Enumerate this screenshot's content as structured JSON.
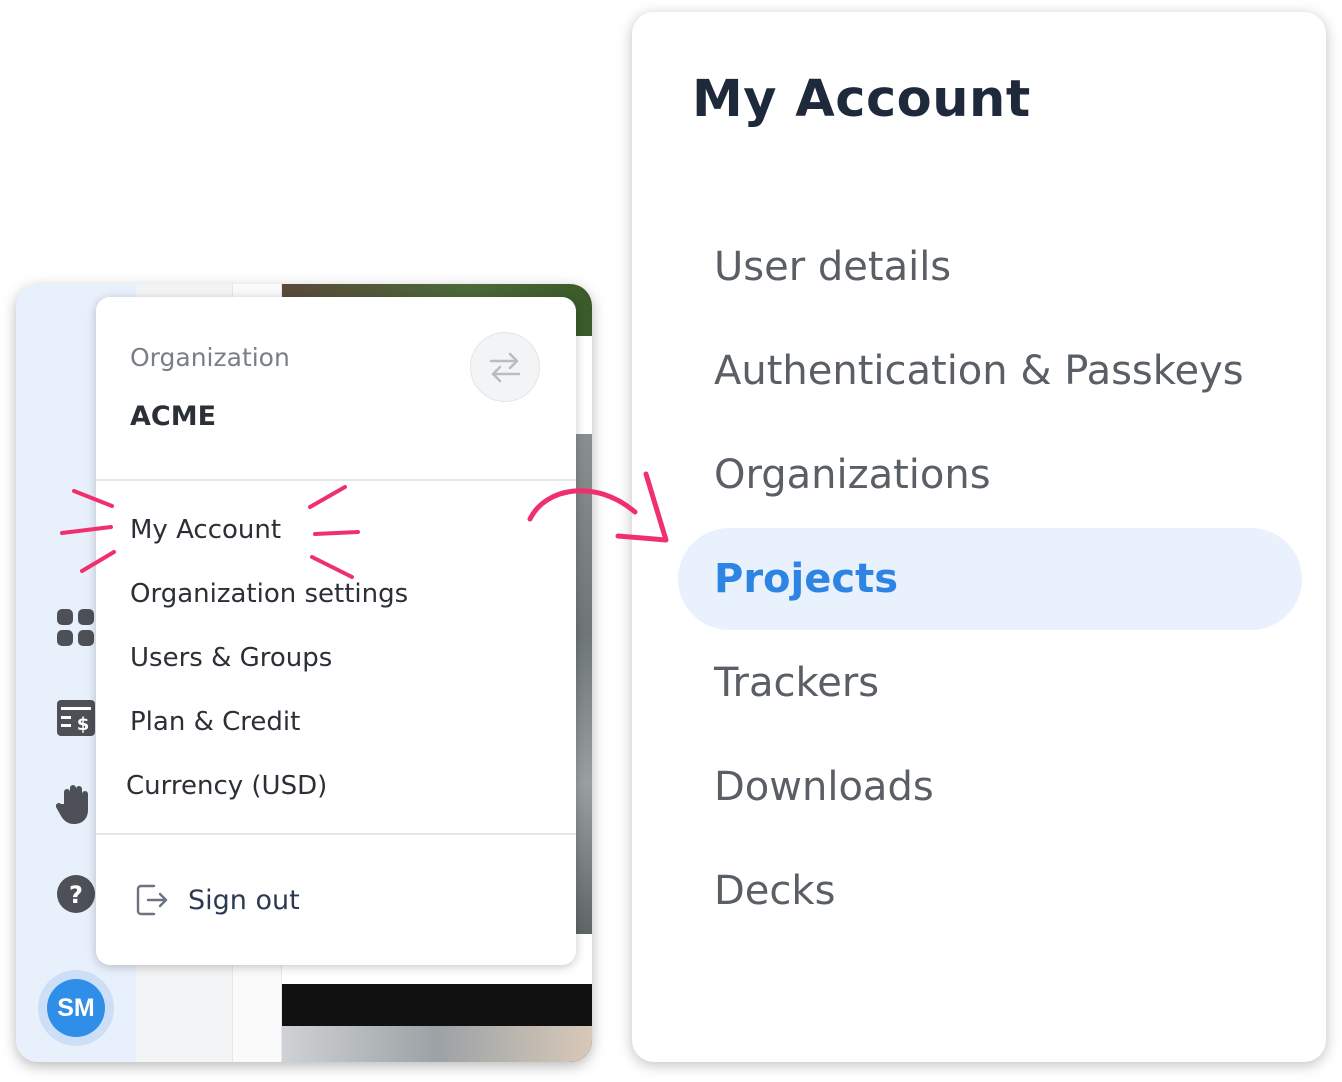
{
  "menu": {
    "org_label": "Organization",
    "org_name": "ACME",
    "items": [
      {
        "label": "My Account"
      },
      {
        "label": "Organization settings"
      },
      {
        "label": "Users & Groups"
      },
      {
        "label": "Plan & Credit"
      },
      {
        "label": "Currency (USD)"
      }
    ],
    "sign_out_label": "Sign out"
  },
  "avatar": {
    "initials": "SM"
  },
  "rail": {
    "icons": [
      "grid-icon",
      "billing-icon",
      "hand-icon",
      "help-icon"
    ]
  },
  "account_panel": {
    "title": "My Account",
    "nav": [
      {
        "label": "User details",
        "active": false
      },
      {
        "label": "Authentication & Passkeys",
        "active": false
      },
      {
        "label": "Organizations",
        "active": false
      },
      {
        "label": "Projects",
        "active": true
      },
      {
        "label": "Trackers",
        "active": false
      },
      {
        "label": "Downloads",
        "active": false
      },
      {
        "label": "Decks",
        "active": false
      }
    ]
  },
  "colors": {
    "accent": "#2e84e3",
    "active_bg": "#e9f1fd",
    "annotation": "#f0306e",
    "rail_bg": "#e8f0fc"
  }
}
